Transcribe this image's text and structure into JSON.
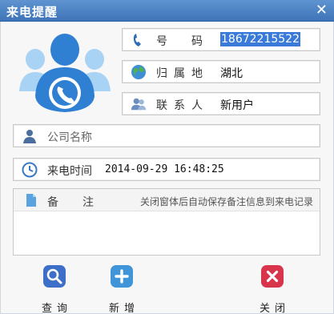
{
  "window": {
    "title": "来电提醒",
    "close_glyph": "✕"
  },
  "phone": {
    "label": "号　码",
    "value": "18672215522",
    "icon": "phone-icon"
  },
  "location": {
    "label": "归属地",
    "value": "湖北",
    "icon": "globe-icon"
  },
  "contact": {
    "label": "联系人",
    "value": "新用户",
    "icon": "contacts-icon"
  },
  "company": {
    "placeholder": "公司名称",
    "icon": "person-icon"
  },
  "call_time": {
    "label": "来电时间",
    "value": "2014-09-29 16:48:25",
    "icon": "clock-icon"
  },
  "notes": {
    "label": "备　注",
    "hint": "关闭窗体后自动保存备注信息到来电记录",
    "value": "",
    "icon": "document-icon"
  },
  "actions": {
    "query": {
      "label": "查询",
      "color": "#3d6fc9",
      "icon": "search-icon"
    },
    "add": {
      "label": "新增",
      "color": "#3f95d8",
      "icon": "plus-icon"
    },
    "close": {
      "label": "关闭",
      "color": "#d8344c",
      "icon": "close-icon"
    }
  },
  "colors": {
    "titlebar": "#4b80c2",
    "selection": "#3a7ad9",
    "avatar_primary": "#2f7fd3",
    "avatar_secondary": "#a9d3f4"
  }
}
